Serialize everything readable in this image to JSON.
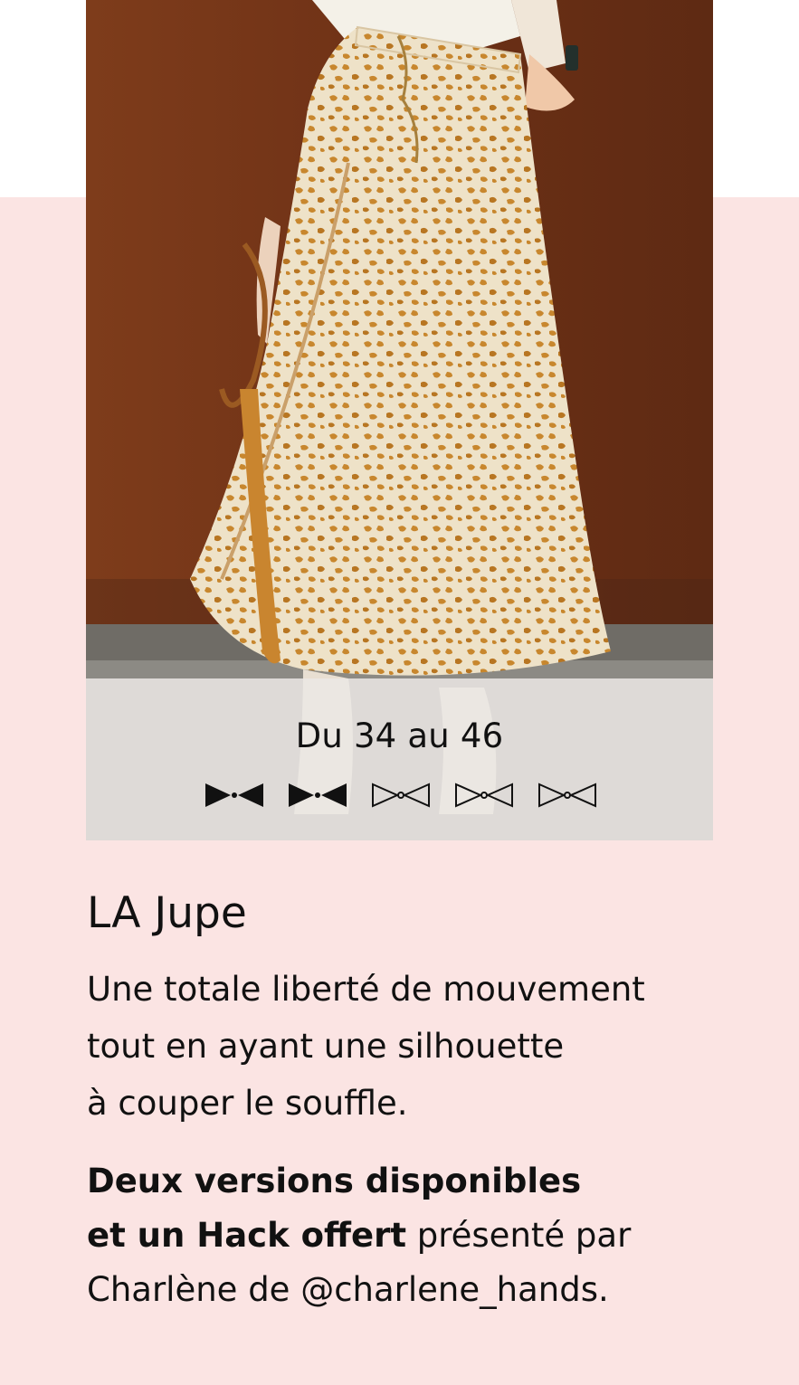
{
  "product": {
    "size_range": "Du 34 au 46",
    "difficulty": {
      "level": 2,
      "max": 5,
      "icon": "bow-tie-icon"
    },
    "title": "LA Jupe",
    "description_lines": [
      "Une totale liberté de mouvement",
      "tout en ayant une silhouette",
      "à couper le souffle."
    ],
    "details": {
      "bold_line_1": "Deux versions disponibles",
      "bold_line_2": "et un Hack offert",
      "text_line_2": " présenté par",
      "text_line_3": "Charlène de @charlene_hands."
    }
  },
  "colors": {
    "background_band": "#fbe4e3",
    "overlay": "#ebe8e4",
    "text": "#111111",
    "wall": "#7a3a1c",
    "skirt": "#eee2c8",
    "leopard_spot": "#c8872e"
  }
}
